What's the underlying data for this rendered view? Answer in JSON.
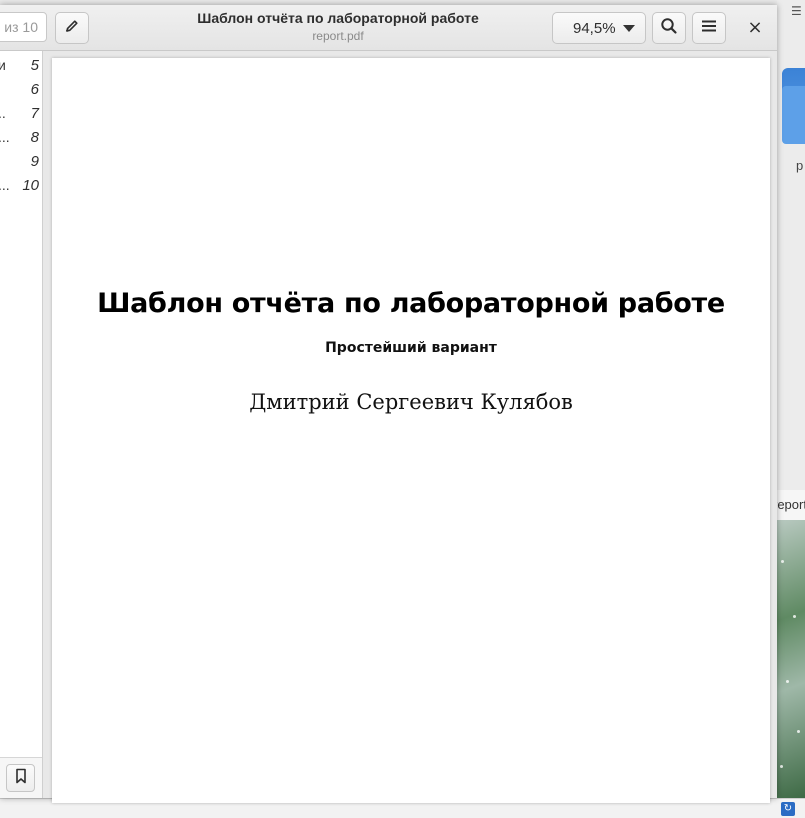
{
  "window": {
    "title": "Шаблон отчёта по лабораторной работе",
    "subtitle": "report.pdf"
  },
  "toolbar": {
    "page_counter": "из 10",
    "zoom_value": "94,5%",
    "close_label": "×"
  },
  "sidebar": {
    "outline": [
      {
        "dots": "и",
        "page": "5"
      },
      {
        "dots": "",
        "page": "6"
      },
      {
        "dots": "..",
        "page": "7"
      },
      {
        "dots": "...",
        "page": "8"
      },
      {
        "dots": "",
        "page": "9"
      },
      {
        "dots": "...",
        "page": "10"
      }
    ]
  },
  "document": {
    "title": "Шаблон отчёта по лабораторной работе",
    "subtitle": "Простейший вариант",
    "author": "Дмитрий Сергеевич Кулябов"
  },
  "background": {
    "side_letter": "р",
    "file_label": "report"
  },
  "icons": {
    "edit": "pencil-icon",
    "search": "search-icon",
    "menu": "hamburger-menu-icon",
    "bookmark": "bookmark-icon",
    "close": "close-icon"
  },
  "colors": {
    "headerbar": "#e9e9e9",
    "accent_blue": "#3b82d6"
  }
}
